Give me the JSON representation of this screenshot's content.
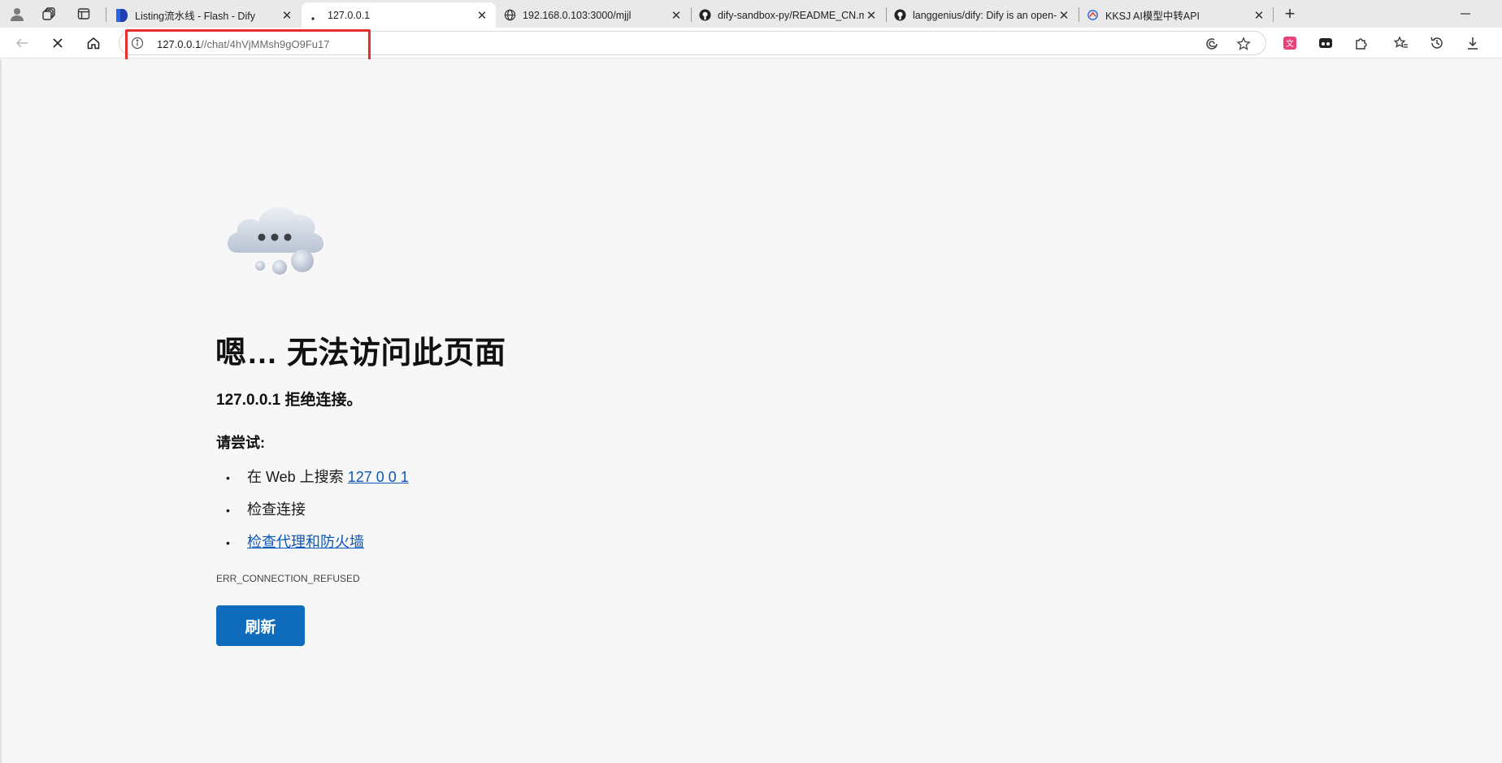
{
  "tabs": [
    {
      "title": "Listing流水线 - Flash - Dify",
      "favicon": "dify-logo-icon",
      "active": false
    },
    {
      "title": "127.0.0.1",
      "favicon": "loading-dot-icon",
      "active": true
    },
    {
      "title": "192.168.0.103:3000/mjjl",
      "favicon": "globe-icon",
      "active": false
    },
    {
      "title": "dify-sandbox-py/README_CN.md",
      "favicon": "github-icon",
      "active": false
    },
    {
      "title": "langgenius/dify: Dify is an open-s",
      "favicon": "github-icon",
      "active": false
    },
    {
      "title": "KKSJ AI模型中转API",
      "favicon": "kksj-logo-icon",
      "active": false
    }
  ],
  "address": {
    "host": "127.0.0.1",
    "path": "//chat/4hVjMMsh9gO9Fu17"
  },
  "error": {
    "heading": "嗯… 无法访问此页面",
    "subtitle": "127.0.0.1 拒绝连接。",
    "try_label": "请尝试:",
    "suggestions": [
      {
        "prefix": "在 Web 上搜索 ",
        "link": "127 0 0 1"
      },
      {
        "prefix": "检查连接",
        "link": ""
      },
      {
        "prefix": "",
        "link": "检查代理和防火墙"
      }
    ],
    "code": "ERR_CONNECTION_REFUSED",
    "button": "刷新"
  },
  "colors": {
    "accent": "#0f6cbd",
    "link": "#0b57b8",
    "highlight": "#e8302f"
  }
}
